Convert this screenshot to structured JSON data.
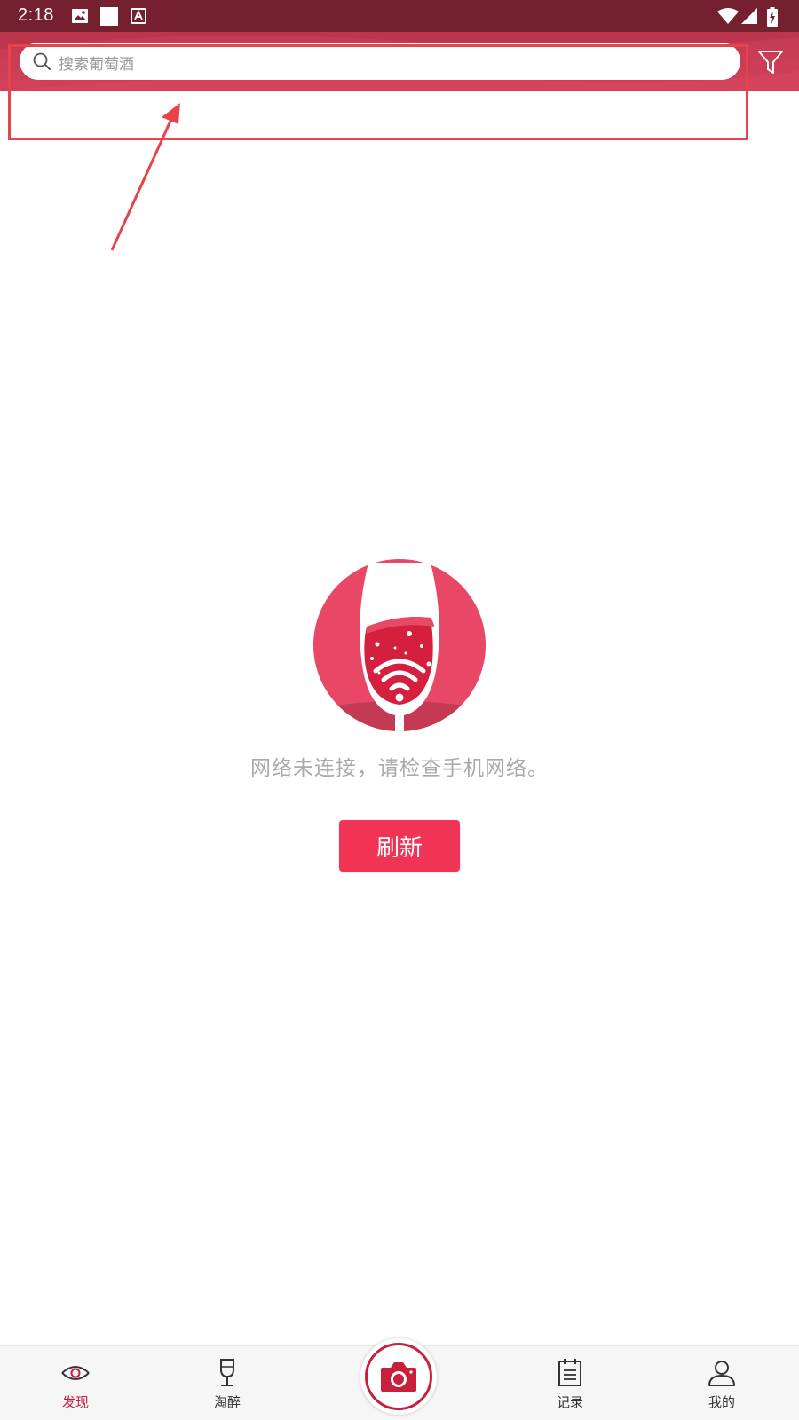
{
  "status_bar": {
    "time": "2:18"
  },
  "search": {
    "placeholder": "搜索葡萄酒"
  },
  "empty_state": {
    "message": "网络未连接，请检查手机网络。",
    "refresh_label": "刷新"
  },
  "bottom_nav": {
    "items": [
      {
        "label": "发现",
        "icon": "eye-icon",
        "active": true
      },
      {
        "label": "淘醉",
        "icon": "wine-glass-icon",
        "active": false
      },
      {
        "label": "记录",
        "icon": "notepad-icon",
        "active": false
      },
      {
        "label": "我的",
        "icon": "user-icon",
        "active": false
      }
    ]
  },
  "colors": {
    "status_bar": "#74202f",
    "header": "#c33a51",
    "accent": "#c81f3d",
    "refresh_button": "#f13355",
    "annotation": "#e8424a"
  }
}
